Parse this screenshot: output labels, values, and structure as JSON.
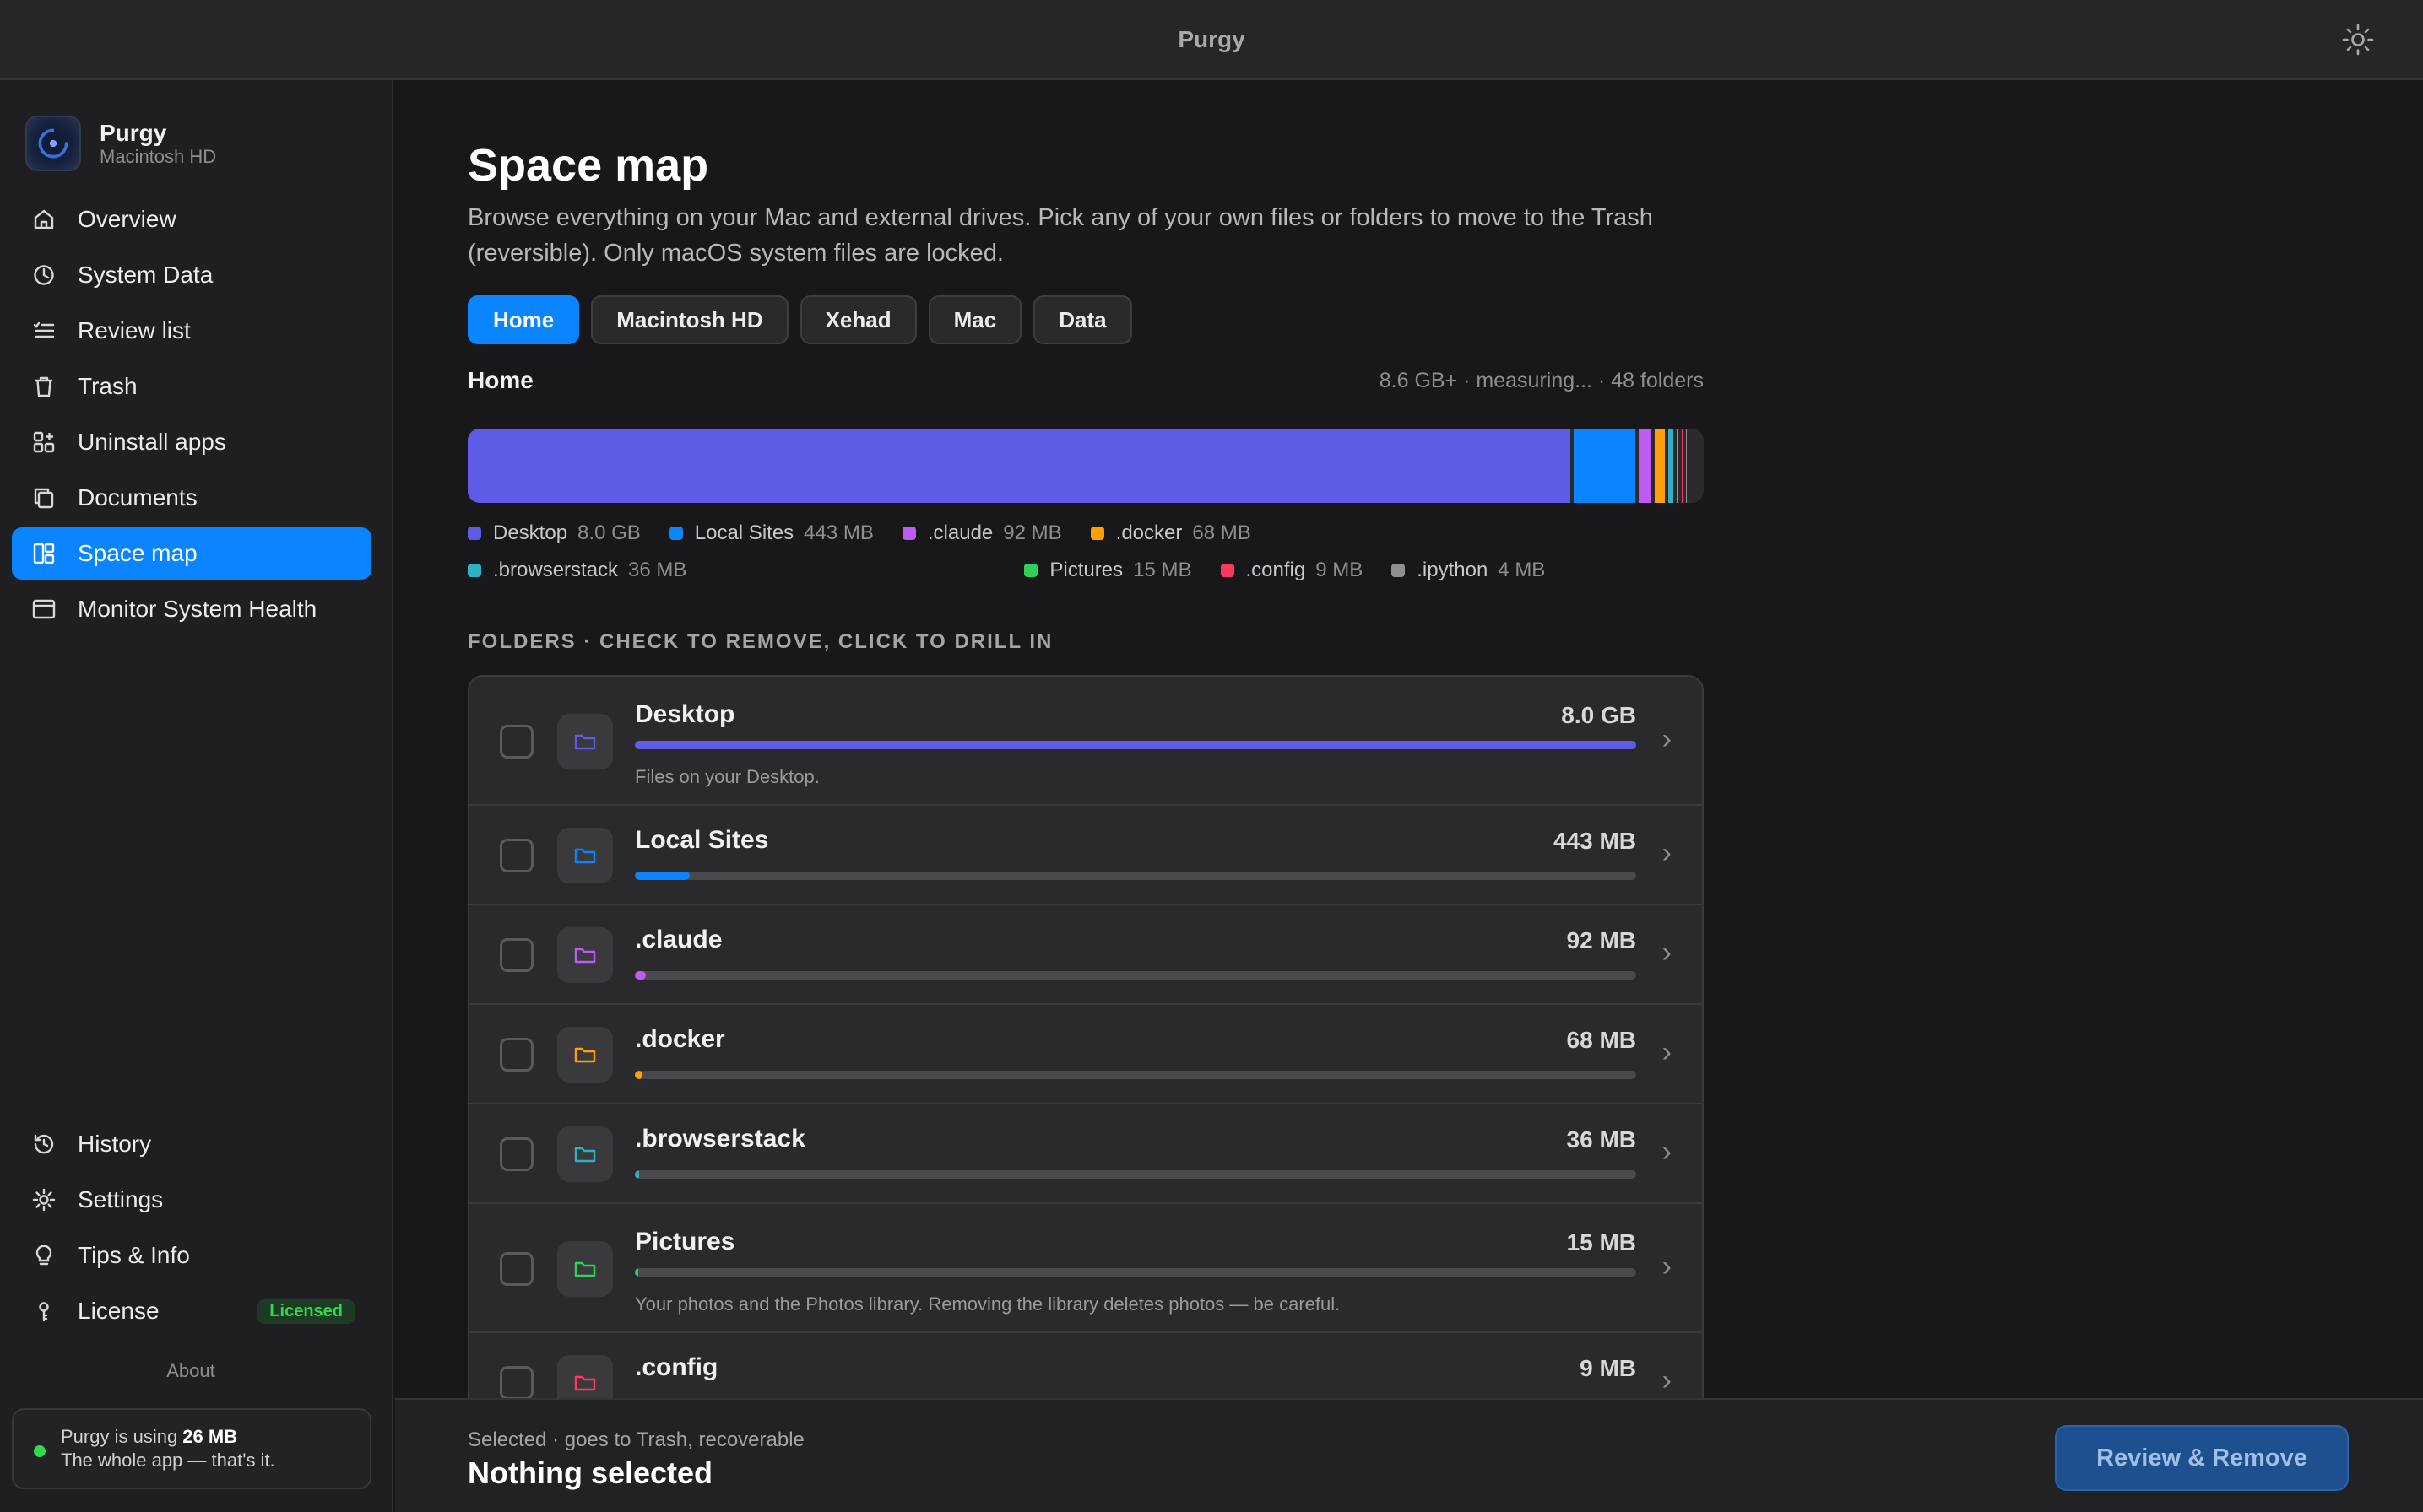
{
  "window": {
    "title": "Purgy"
  },
  "sidebar": {
    "app_name": "Purgy",
    "volume": "Macintosh HD",
    "items": [
      {
        "label": "Overview",
        "icon": "house-icon"
      },
      {
        "label": "System Data",
        "icon": "clock-icon"
      },
      {
        "label": "Review list",
        "icon": "checklist-icon"
      },
      {
        "label": "Trash",
        "icon": "trash-icon"
      },
      {
        "label": "Uninstall apps",
        "icon": "apps-grid-icon"
      },
      {
        "label": "Documents",
        "icon": "documents-icon"
      },
      {
        "label": "Space map",
        "icon": "space-map-icon",
        "active": true
      },
      {
        "label": "Monitor System Health",
        "icon": "monitor-icon"
      }
    ],
    "bottom_items": [
      {
        "label": "History",
        "icon": "history-icon"
      },
      {
        "label": "Settings",
        "icon": "gear-icon"
      },
      {
        "label": "Tips & Info",
        "icon": "lightbulb-icon"
      },
      {
        "label": "License",
        "icon": "key-icon",
        "badge": "Licensed"
      }
    ],
    "about": "About",
    "usage": {
      "prefix": "Purgy is using ",
      "amount": "26 MB",
      "tagline": "The whole app — that's it."
    }
  },
  "main": {
    "title": "Space map",
    "description": "Browse everything on your Mac and external drives. Pick any of your own files or folders to move to the Trash (reversible). Only macOS system files are locked.",
    "scopes": [
      {
        "label": "Home",
        "active": true
      },
      {
        "label": "Macintosh HD"
      },
      {
        "label": "Xehad"
      },
      {
        "label": "Mac"
      },
      {
        "label": "Data"
      }
    ],
    "current": "Home",
    "meta": "8.6 GB+ · measuring... · 48 folders",
    "section_label": "FOLDERS · CHECK TO REMOVE, CLICK TO DRILL IN"
  },
  "legend": [
    {
      "name": "Desktop",
      "size": "8.0 GB",
      "color": "#5e5ce6",
      "fraction": 0.892
    },
    {
      "name": "Local Sites",
      "size": "443 MB",
      "color": "#0a84ff",
      "fraction": 0.05
    },
    {
      "name": ".claude",
      "size": "92 MB",
      "color": "#bf5af2",
      "fraction": 0.0104
    },
    {
      "name": ".docker",
      "size": "68 MB",
      "color": "#ff9f0a",
      "fraction": 0.0077
    },
    {
      "name": ".browserstack",
      "size": "36 MB",
      "color": "#30b0c7",
      "fraction": 0.0041
    },
    {
      "name": "Pictures",
      "size": "15 MB",
      "color": "#30d158",
      "fraction": 0.0017
    },
    {
      "name": ".config",
      "size": "9 MB",
      "color": "#ff375f",
      "fraction": 0.001
    },
    {
      "name": ".ipython",
      "size": "4 MB",
      "color": "#8e8e93",
      "fraction": 0.0005
    }
  ],
  "folders": [
    {
      "name": "Desktop",
      "size": "8.0 GB",
      "color": "#5e5ce6",
      "fill": 1.0,
      "desc": "Files on your Desktop."
    },
    {
      "name": "Local Sites",
      "size": "443 MB",
      "color": "#0a84ff",
      "fill": 0.055,
      "desc": ""
    },
    {
      "name": ".claude",
      "size": "92 MB",
      "color": "#bf5af2",
      "fill": 0.011,
      "desc": ""
    },
    {
      "name": ".docker",
      "size": "68 MB",
      "color": "#ff9f0a",
      "fill": 0.008,
      "desc": ""
    },
    {
      "name": ".browserstack",
      "size": "36 MB",
      "color": "#30b0c7",
      "fill": 0.004,
      "desc": ""
    },
    {
      "name": "Pictures",
      "size": "15 MB",
      "color": "#30d158",
      "fill": 0.002,
      "desc": "Your photos and the Photos library. Removing the library deletes photos — be careful."
    },
    {
      "name": ".config",
      "size": "9 MB",
      "color": "#ff375f",
      "fill": 0.001,
      "desc": ""
    }
  ],
  "footer": {
    "caption": "Selected · goes to Trash, recoverable",
    "value": "Nothing selected",
    "button": "Review & Remove"
  }
}
